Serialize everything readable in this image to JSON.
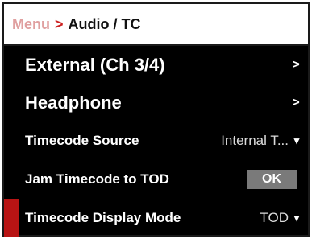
{
  "breadcrumb": {
    "root": "Menu",
    "separator": ">",
    "current": "Audio / TC"
  },
  "menu": {
    "items": [
      {
        "label": "External (Ch 3/4)",
        "type": "submenu",
        "chevron": ">"
      },
      {
        "label": "Headphone",
        "type": "submenu",
        "chevron": ">"
      },
      {
        "label": "Timecode Source",
        "type": "dropdown",
        "value": "Internal T...",
        "chevron": "▾"
      },
      {
        "label": "Jam Timecode to TOD",
        "type": "action",
        "button": "OK"
      },
      {
        "label": "Timecode Display Mode",
        "type": "dropdown",
        "value": "TOD",
        "chevron": "▾",
        "selected": true
      }
    ]
  },
  "colors": {
    "background": "#000000",
    "header_bg": "#ffffff",
    "accent": "#b81414",
    "button_bg": "#7a7a7a"
  }
}
